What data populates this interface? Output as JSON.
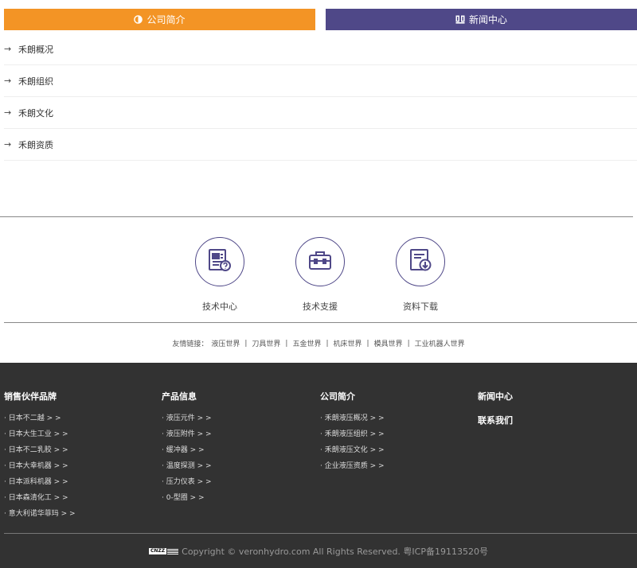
{
  "tabs": [
    {
      "label": "公司简介",
      "icon": "half-circle-icon",
      "color": "#f39425"
    },
    {
      "label": "新闻中心",
      "icon": "book-icon",
      "color": "#4f4888"
    }
  ],
  "menu": {
    "arrow": "→",
    "items": [
      "禾朗概况",
      "禾朗组织",
      "禾朗文化",
      "禾朗资质"
    ]
  },
  "services": [
    {
      "label": "技术中心",
      "icon": "document-question-icon"
    },
    {
      "label": "技术支援",
      "icon": "toolbox-icon"
    },
    {
      "label": "资料下载",
      "icon": "download-document-icon"
    }
  ],
  "friend_links": {
    "label": "友情链接：",
    "items": [
      "液压世界",
      "刀具世界",
      "五金世界",
      "机床世界",
      "模具世界",
      "工业机器人世界"
    ],
    "separator": "|"
  },
  "footer": {
    "columns": [
      {
        "title": "销售伙伴品牌",
        "items": [
          "· 日本不二越 > >",
          "· 日本大生工业 > >",
          "· 日本不二乳胶 > >",
          "· 日本大幸机器 > >",
          "· 日本派科机器 > >",
          "· 日本森清化工 > >",
          "· 意大利诺华菲玛 > >"
        ]
      },
      {
        "title": "产品信息",
        "items": [
          "· 液压元件 > >",
          "· 液压附件 > >",
          "· 缓冲器 > >",
          "· 温度探测 > >",
          "· 压力仪表 > >",
          "· 0-型圈 > >"
        ]
      },
      {
        "title": "公司简介",
        "items": [
          "· 禾朗液压概况 > >",
          "· 禾朗液压组织 > >",
          "· 禾朗液压文化 > >",
          "· 企业液压资质 > >"
        ]
      },
      {
        "title": "新闻中心",
        "title2": "联系我们"
      }
    ],
    "badge_text": "CNZZ",
    "copyright": "Copyright © veronhydro.com All Rights Reserved. 粤ICP备19113520号"
  }
}
